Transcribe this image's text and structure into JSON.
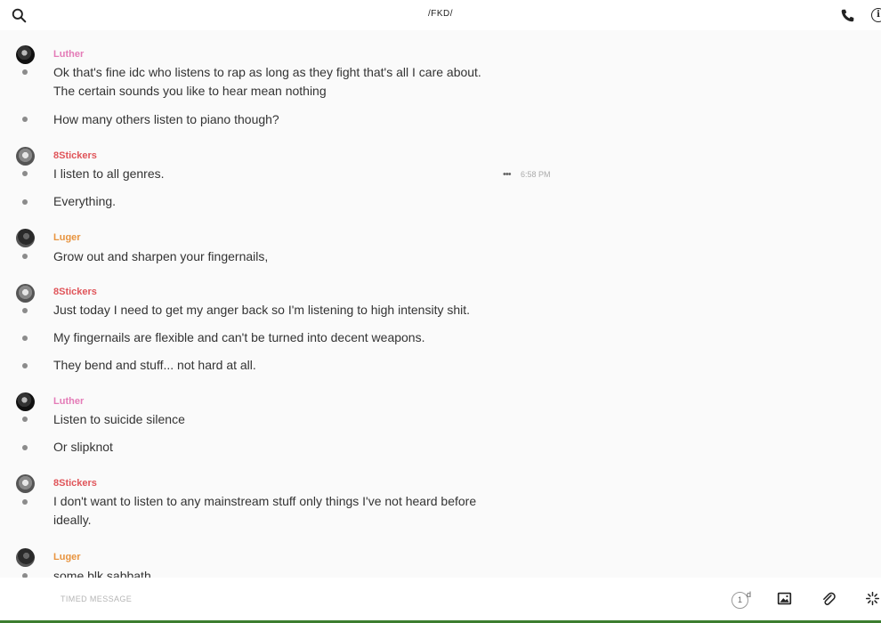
{
  "header": {
    "title": "/FKD/",
    "icons": {
      "search": "search-icon",
      "phone": "phone-icon",
      "info": "info-icon"
    },
    "info_glyph": "i"
  },
  "authors": {
    "luther": {
      "name": "Luther",
      "color": "#e47bb7"
    },
    "stickers": {
      "name": "8Stickers",
      "color": "#e0555a"
    },
    "luger": {
      "name": "Luger",
      "color": "#e8943f"
    }
  },
  "messages": [
    {
      "author": "Luther",
      "lines": [
        "Ok that's fine idc who listens to rap as long as they fight that's all I care about.",
        "The certain sounds you like to hear mean nothing"
      ]
    },
    {
      "author": "Luther",
      "lines": [
        "How many others listen to piano though?"
      ]
    },
    {
      "author": "8Stickers",
      "lines": [
        "I listen to all genres."
      ],
      "hover": {
        "more": "•••",
        "time": "6:58 PM"
      }
    },
    {
      "author": "8Stickers",
      "lines": [
        "Everything."
      ]
    },
    {
      "author": "Luger",
      "lines": [
        "Grow out and sharpen your fingernails,"
      ]
    },
    {
      "author": "8Stickers",
      "lines": [
        "Just today I need to get my anger back so I'm listening to high intensity shit."
      ]
    },
    {
      "author": "8Stickers",
      "lines": [
        "My fingernails are flexible and can't be turned into decent weapons."
      ]
    },
    {
      "author": "8Stickers",
      "lines": [
        "They bend and stuff... not hard at all."
      ]
    },
    {
      "author": "Luther",
      "lines": [
        "Listen to suicide silence"
      ]
    },
    {
      "author": "Luther",
      "lines": [
        "Or slipknot"
      ]
    },
    {
      "author": "8Stickers",
      "lines": [
        "I don't want to listen to any mainstream stuff only things I've not heard before",
        "ideally."
      ]
    },
    {
      "author": "Luger",
      "lines": [
        "some blk sabbath"
      ]
    }
  ],
  "composer": {
    "placeholder": "TIMED MESSAGE",
    "timer_value": "1",
    "timer_unit": "d",
    "icons": {
      "timer": "timer-icon",
      "image": "image-icon",
      "attach": "paperclip-icon",
      "sparkle": "sparkle-icon"
    }
  },
  "colors": {
    "accent_bottom": "#3c7d2f"
  }
}
